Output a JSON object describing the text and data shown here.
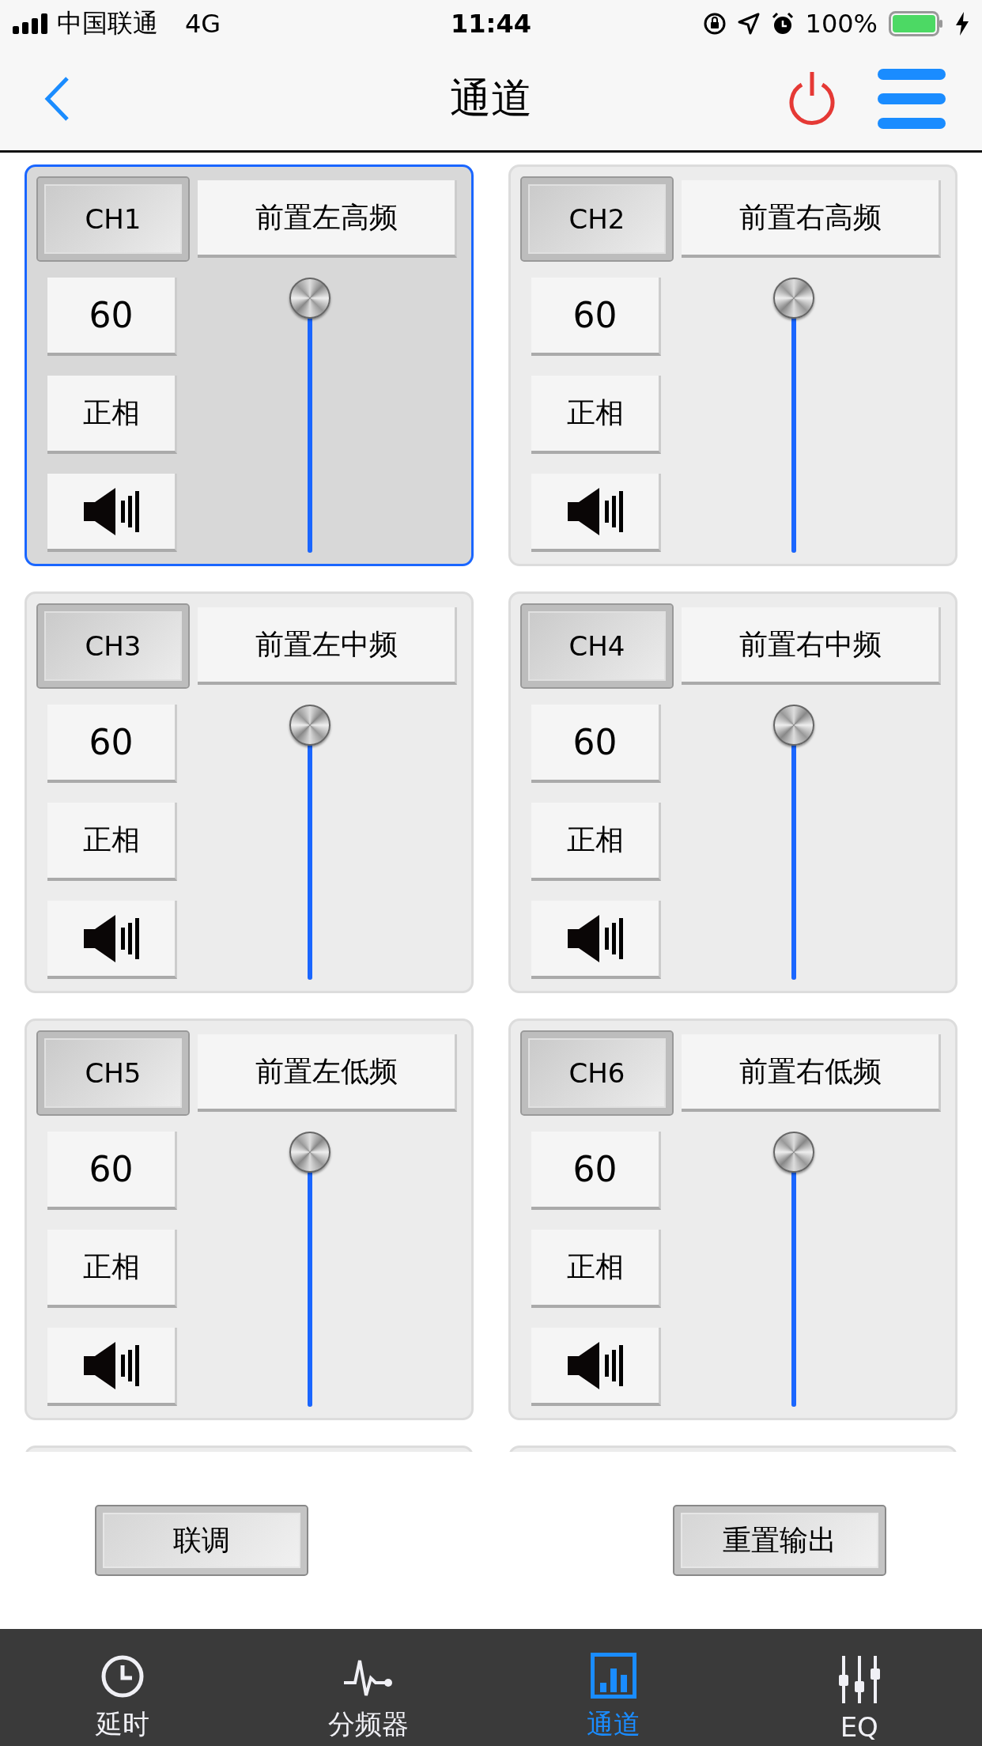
{
  "status_bar": {
    "carrier": "中国联通",
    "network": "4G",
    "time": "11:44",
    "battery": "100%"
  },
  "header": {
    "title": "通道"
  },
  "channels": [
    {
      "label": "CH1",
      "name": "前置左高频",
      "value": "60",
      "phase": "正相",
      "muted": false,
      "level": 1,
      "selected": true
    },
    {
      "label": "CH2",
      "name": "前置右高频",
      "value": "60",
      "phase": "正相",
      "muted": false,
      "level": 1,
      "selected": false
    },
    {
      "label": "CH3",
      "name": "前置左中频",
      "value": "60",
      "phase": "正相",
      "muted": false,
      "level": 1,
      "selected": false
    },
    {
      "label": "CH4",
      "name": "前置右中频",
      "value": "60",
      "phase": "正相",
      "muted": false,
      "level": 1,
      "selected": false
    },
    {
      "label": "CH5",
      "name": "前置左低频",
      "value": "60",
      "phase": "正相",
      "muted": false,
      "level": 1,
      "selected": false
    },
    {
      "label": "CH6",
      "name": "前置右低频",
      "value": "60",
      "phase": "正相",
      "muted": false,
      "level": 1,
      "selected": false
    }
  ],
  "actions": [
    "联调",
    "重置输出"
  ],
  "tabs": [
    {
      "label": "延时",
      "kind": "clock",
      "selected": false
    },
    {
      "label": "分频器",
      "kind": "pulse",
      "selected": false
    },
    {
      "label": "通道",
      "kind": "bars",
      "selected": true
    },
    {
      "label": "EQ",
      "kind": "sliders",
      "selected": false
    }
  ]
}
